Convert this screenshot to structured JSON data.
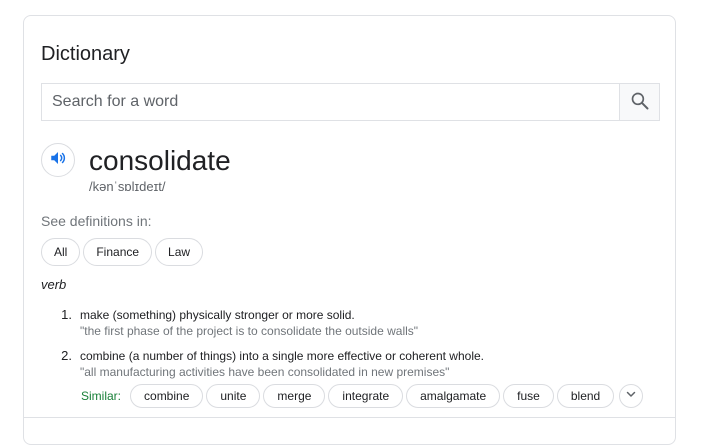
{
  "card": {
    "title": "Dictionary"
  },
  "search": {
    "placeholder": "Search for a word",
    "value": ""
  },
  "entry": {
    "word": "consolidate",
    "phonetic": "/kənˈsɒlɪdeɪt/",
    "see_definitions_label": "See definitions in:",
    "sources": [
      "All",
      "Finance",
      "Law"
    ],
    "part_of_speech": "verb",
    "definitions": [
      {
        "number": "1.",
        "text": "make (something) physically stronger or more solid.",
        "example": "\"the first phase of the project is to consolidate the outside walls\""
      },
      {
        "number": "2.",
        "text": "combine (a number of things) into a single more effective or coherent whole.",
        "example": "\"all manufacturing activities have been consolidated in new premises\""
      }
    ],
    "similar_label": "Similar:",
    "similar": [
      "combine",
      "unite",
      "merge",
      "integrate",
      "amalgamate",
      "fuse",
      "blend"
    ]
  },
  "icons": {
    "search": "search-icon",
    "speaker": "speaker-icon",
    "expand": "chevron-down-icon"
  },
  "colors": {
    "accent_blue": "#1a73e8",
    "similar_green": "#188038",
    "example_gray": "#70757a",
    "border": "#dfe1e5"
  }
}
